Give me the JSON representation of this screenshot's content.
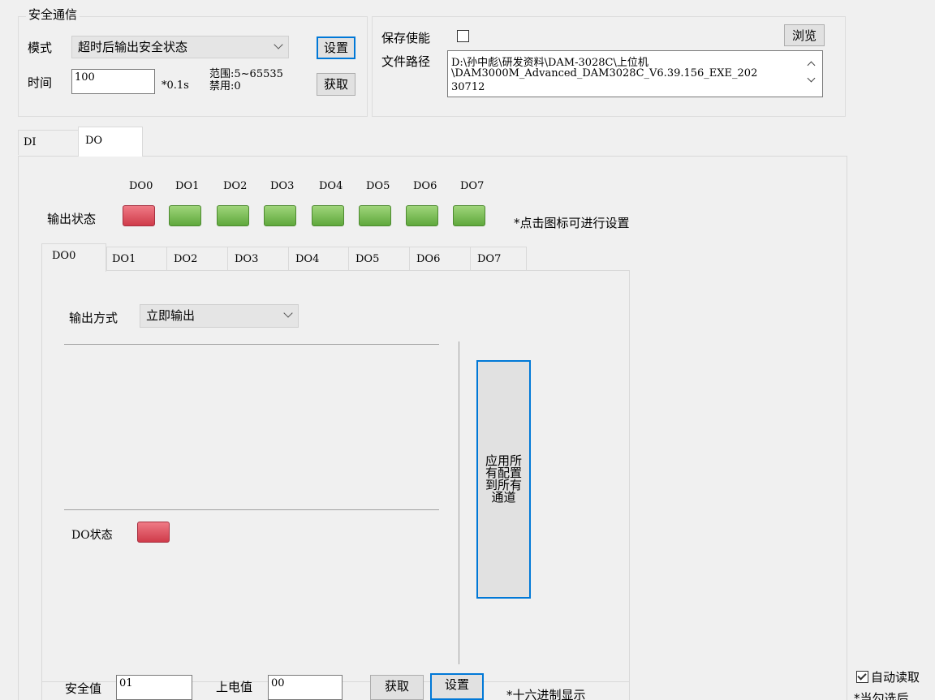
{
  "safe_comm": {
    "title": "安全通信",
    "mode_label": "模式",
    "mode_value": "超时后输出安全状态",
    "time_label": "时间",
    "time_value": "100",
    "time_unit": "*0.1s",
    "range_text": "范围:5~65535",
    "disable_text": "禁用:0",
    "set_label": "设置",
    "get_label": "获取"
  },
  "save": {
    "enable_label": "保存使能",
    "enabled": false,
    "path_label": "文件路径",
    "path_line1": "D:\\孙中彪\\研发资料\\DAM-3028C\\上位机",
    "path_line2": "\\DAM3000M_Advanced_DAM3028C_V6.39.156_EXE_202",
    "path_line3": "30712",
    "browse_label": "浏览"
  },
  "main_tabs": [
    "DI",
    "DO"
  ],
  "main_tab_active": "DO",
  "output_state": {
    "label": "输出状态",
    "hint": "*点击图标可进行设置",
    "channels": [
      "DO0",
      "DO1",
      "DO2",
      "DO3",
      "DO4",
      "DO5",
      "DO6",
      "DO7"
    ],
    "states": [
      "on",
      "off",
      "off",
      "off",
      "off",
      "off",
      "off",
      "off"
    ],
    "color_on": "#d9424f",
    "color_off": "#6ab347"
  },
  "channel_tabs": [
    "DO0",
    "DO1",
    "DO2",
    "DO3",
    "DO4",
    "DO5",
    "DO6",
    "DO7"
  ],
  "channel_tab_active": "DO0",
  "channel_panel": {
    "output_mode_label": "输出方式",
    "output_mode_value": "立即输出",
    "do_state_label": "DO状态",
    "apply_all_label": "应用所有配置到所有通道"
  },
  "bottom": {
    "safe_value_label": "安全值",
    "safe_value": "01",
    "power_value_label": "上电值",
    "power_value": "00",
    "get_label": "获取",
    "set_label": "设置",
    "hex_hint": "*十六进制显示"
  },
  "auto_read": {
    "label": "自动读取",
    "checked": true,
    "partial_text": "*当勾选后"
  }
}
